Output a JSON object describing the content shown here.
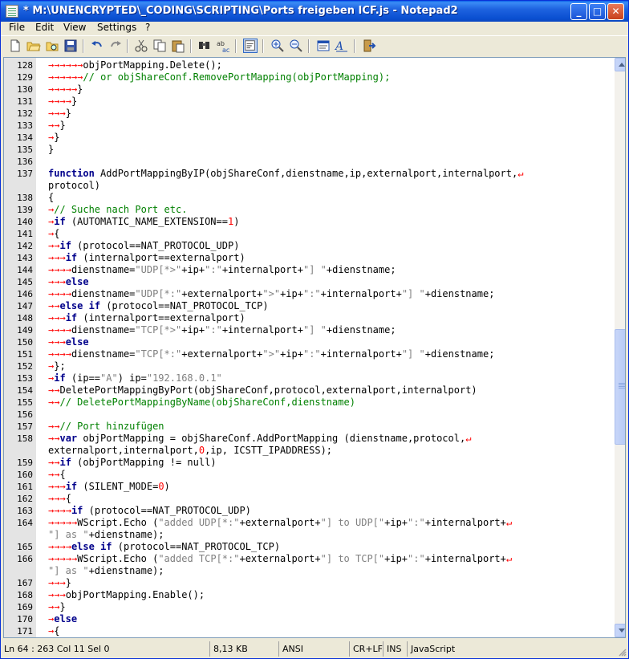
{
  "window": {
    "title": "* M:\\UNENCRYPTED\\_CODING\\SCRIPTING\\Ports freigeben ICF.js - Notepad2"
  },
  "menu": [
    {
      "label": "File"
    },
    {
      "label": "Edit"
    },
    {
      "label": "View"
    },
    {
      "label": "Settings"
    },
    {
      "label": "?"
    }
  ],
  "toolbar": [
    "new-file-icon",
    "open-folder-icon",
    "browse-icon",
    "save-icon",
    "undo-icon",
    "redo-icon",
    "cut-icon",
    "copy-icon",
    "paste-icon",
    "find-icon",
    "replace-icon",
    "word-wrap-icon",
    "zoom-in-icon",
    "zoom-out-icon",
    "scheme-icon",
    "font-icon",
    "exit-icon"
  ],
  "colors": {
    "keyword": "#00008B",
    "comment": "#008000",
    "string": "#808080",
    "number": "#FF0000",
    "whitespace": "#FF0000"
  },
  "code": [
    {
      "n": "128",
      "t": "→→→→→→objPortMapping.Delete();"
    },
    {
      "n": "129",
      "t": "→→→→→→// or objShareConf.RemovePortMapping(objPortMapping);"
    },
    {
      "n": "130",
      "t": "→→→→→}"
    },
    {
      "n": "131",
      "t": "→→→→}"
    },
    {
      "n": "132",
      "t": "→→→}"
    },
    {
      "n": "133",
      "t": "→→}"
    },
    {
      "n": "134",
      "t": "→}"
    },
    {
      "n": "135",
      "t": "}"
    },
    {
      "n": "136",
      "t": ""
    },
    {
      "n": "137",
      "t": "function AddPortMappingByIP(objShareConf,dienstname,ip,externalport,internalport,↵"
    },
    {
      "n": "",
      "t": "protocol)"
    },
    {
      "n": "138",
      "t": "{"
    },
    {
      "n": "139",
      "t": "→// Suche nach Port etc."
    },
    {
      "n": "140",
      "t": "→if (AUTOMATIC_NAME_EXTENSION==1)"
    },
    {
      "n": "141",
      "t": "→{"
    },
    {
      "n": "142",
      "t": "→→if (protocol==NAT_PROTOCOL_UDP)"
    },
    {
      "n": "143",
      "t": "→→→if (internalport==externalport)"
    },
    {
      "n": "144",
      "t": "→→→→dienstname=\"UDP[*>\"+ip+\":\"+internalport+\"] \"+dienstname;"
    },
    {
      "n": "145",
      "t": "→→→else"
    },
    {
      "n": "146",
      "t": "→→→→dienstname=\"UDP[*:\"+externalport+\">\"+ip+\":\"+internalport+\"] \"+dienstname;"
    },
    {
      "n": "147",
      "t": "→→else if (protocol==NAT_PROTOCOL_TCP)"
    },
    {
      "n": "148",
      "t": "→→→if (internalport==externalport)"
    },
    {
      "n": "149",
      "t": "→→→→dienstname=\"TCP[*>\"+ip+\":\"+internalport+\"] \"+dienstname;"
    },
    {
      "n": "150",
      "t": "→→→else"
    },
    {
      "n": "151",
      "t": "→→→→dienstname=\"TCP[*:\"+externalport+\">\"+ip+\":\"+internalport+\"] \"+dienstname;"
    },
    {
      "n": "152",
      "t": "→};"
    },
    {
      "n": "153",
      "t": "→if (ip==\"A\") ip=\"192.168.0.1\""
    },
    {
      "n": "154",
      "t": "→→DeletePortMappingByPort(objShareConf,protocol,externalport,internalport)"
    },
    {
      "n": "155",
      "t": "→→// DeletePortMappingByName(objShareConf,dienstname)"
    },
    {
      "n": "156",
      "t": ""
    },
    {
      "n": "157",
      "t": "→→// Port hinzufügen"
    },
    {
      "n": "158",
      "t": "→→var objPortMapping = objShareConf.AddPortMapping (dienstname,protocol,↵"
    },
    {
      "n": "",
      "t": "externalport,internalport,0,ip, ICSTT_IPADDRESS);"
    },
    {
      "n": "159",
      "t": "→→if (objPortMapping != null) "
    },
    {
      "n": "160",
      "t": "→→{"
    },
    {
      "n": "161",
      "t": "→→→if (SILENT_MODE=0)"
    },
    {
      "n": "162",
      "t": "→→→{"
    },
    {
      "n": "163",
      "t": "→→→→if (protocol==NAT_PROTOCOL_UDP)"
    },
    {
      "n": "164",
      "t": "→→→→→WScript.Echo (\"added UDP[*:\"+externalport+\"] to UDP[\"+ip+\":\"+internalport+↵"
    },
    {
      "n": "",
      "t": "\"] as \"+dienstname);"
    },
    {
      "n": "165",
      "t": "→→→→else if (protocol==NAT_PROTOCOL_TCP)"
    },
    {
      "n": "166",
      "t": "→→→→→WScript.Echo (\"added TCP[*:\"+externalport+\"] to TCP[\"+ip+\":\"+internalport+↵"
    },
    {
      "n": "",
      "t": "\"] as \"+dienstname);"
    },
    {
      "n": "167",
      "t": "→→→}"
    },
    {
      "n": "168",
      "t": "→→→objPortMapping.Enable();"
    },
    {
      "n": "169",
      "t": "→→}"
    },
    {
      "n": "170",
      "t": "→else"
    },
    {
      "n": "171",
      "t": "→{"
    }
  ],
  "status": {
    "position": "Ln 64 : 263   Col 11   Sel 0",
    "size": "8,13 KB",
    "encoding": "ANSI",
    "eol": "CR+LF",
    "mode": "INS",
    "lexer": "JavaScript"
  }
}
